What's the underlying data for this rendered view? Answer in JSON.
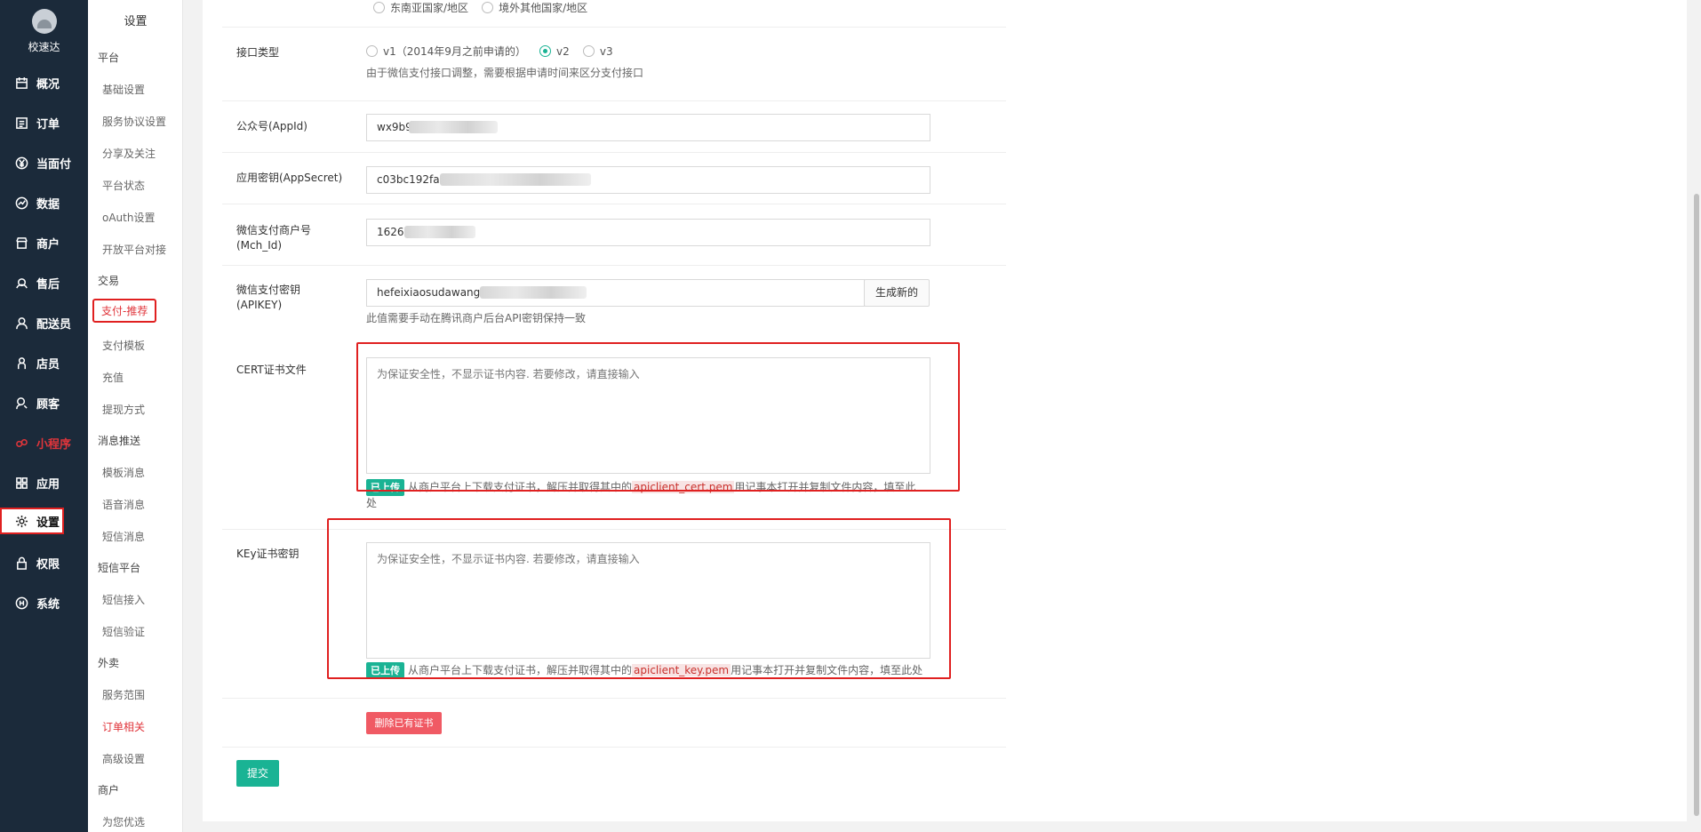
{
  "brand": {
    "name": "校速达"
  },
  "nav": [
    {
      "label": "概况",
      "icon": "calendar-icon"
    },
    {
      "label": "订单",
      "icon": "list-icon"
    },
    {
      "label": "当面付",
      "icon": "yuan-icon"
    },
    {
      "label": "数据",
      "icon": "chart-icon"
    },
    {
      "label": "商户",
      "icon": "store-icon"
    },
    {
      "label": "售后",
      "icon": "headset-icon"
    },
    {
      "label": "配送员",
      "icon": "user-icon"
    },
    {
      "label": "店员",
      "icon": "person-icon"
    },
    {
      "label": "顾客",
      "icon": "customer-icon"
    },
    {
      "label": "小程序",
      "icon": "miniprogram-icon"
    },
    {
      "label": "应用",
      "icon": "apps-icon"
    },
    {
      "label": "设置",
      "icon": "gear-icon"
    },
    {
      "label": "权限",
      "icon": "lock-icon"
    },
    {
      "label": "系统",
      "icon": "system-icon"
    }
  ],
  "submenu": {
    "title": "设置",
    "groups": {
      "platform": "平台",
      "trade": "交易",
      "message": "消息推送",
      "sms": "短信平台",
      "takeout": "外卖",
      "merchant": "商户"
    },
    "items": {
      "basic": "基础设置",
      "agreement": "服务协议设置",
      "share": "分享及关注",
      "status": "平台状态",
      "oauth": "oAuth设置",
      "open": "开放平台对接",
      "pay": "支付-推荐",
      "paytpl": "支付模板",
      "recharge": "充值",
      "withdraw": "提现方式",
      "tplmsg": "模板消息",
      "voice": "语音消息",
      "smsmsg": "短信消息",
      "smsin": "短信接入",
      "smsverify": "短信验证",
      "range": "服务范围",
      "orderrel": "订单相关",
      "advanced": "高级设置",
      "recommend": "为您优选"
    }
  },
  "form": {
    "top_radios": [
      "东南亚国家/地区",
      "境外其他国家/地区"
    ],
    "api_type": {
      "label": "接口类型",
      "options": [
        "v1（2014年9月之前申请的）",
        "v2",
        "v3"
      ],
      "selected": "v2",
      "help": "由于微信支付接口调整，需要根据申请时间来区分支付接口"
    },
    "appid": {
      "label": "公众号(AppId)",
      "value": "wx9b96"
    },
    "appsecret": {
      "label": "应用密钥(AppSecret)",
      "value": "c03bc192fa5"
    },
    "mchid": {
      "label1": "微信支付商户号",
      "label2": "(Mch_Id)",
      "value": "16260"
    },
    "apikey": {
      "label1": "微信支付密钥",
      "label2": "(APIKEY)",
      "value": "hefeixiaosudawang",
      "button": "生成新的",
      "help": "此值需要手动在腾讯商户后台API密钥保持一致"
    },
    "cert": {
      "label": "CERT证书文件",
      "placeholder": "为保证安全性，不显示证书内容. 若要修改，请直接输入",
      "badge": "已上传",
      "help_pre": "从商户平台上下载支付证书，解压并取得其中的",
      "file": "apiclient_cert.pem",
      "help_post1": "用记事本打开并复制文件内容，填至此",
      "help_post2": "处"
    },
    "key": {
      "label": "KEy证书密钥",
      "placeholder": "为保证安全性，不显示证书内容. 若要修改，请直接输入",
      "badge": "已上传",
      "help_pre": "从商户平台上下载支付证书，解压并取得其中的",
      "file": "apiclient_key.pem",
      "help_post": "用记事本打开并复制文件内容，填至此处"
    },
    "delete_button": "删除已有证书",
    "submit_button": "提交"
  },
  "colors": {
    "nav_bg": "#1b2a3a",
    "accent": "#1ab394",
    "danger": "#f05a64",
    "highlight": "#e02020"
  }
}
